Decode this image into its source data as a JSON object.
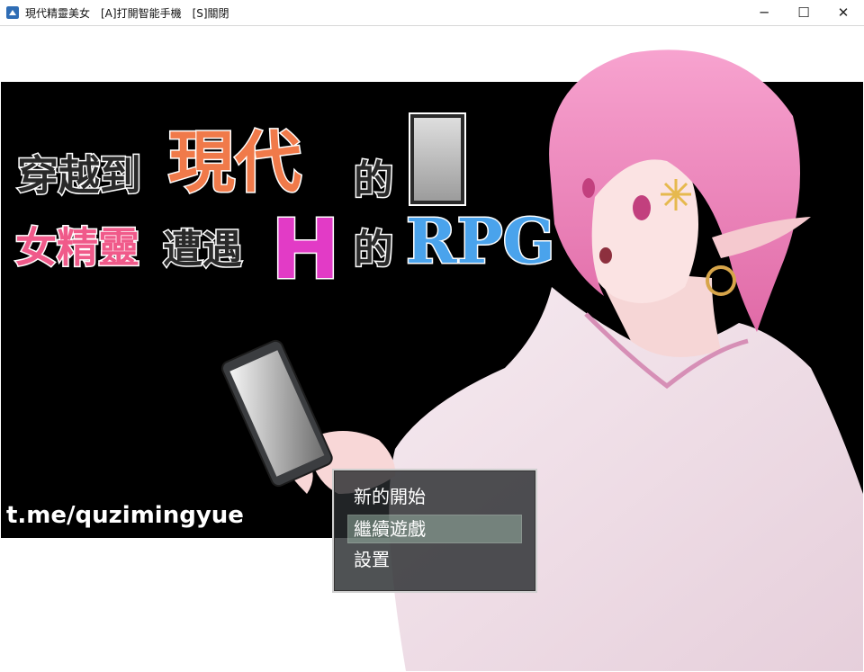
{
  "window": {
    "title": "現代精靈美女　[A]打開智能手機　[S]關閉",
    "minimize_glyph": "─",
    "maximize_glyph": "☐",
    "close_glyph": "✕",
    "icon": "app-icon"
  },
  "game_title": {
    "line1_a": "穿越到",
    "line1_b": "現代",
    "line1_c": "的",
    "line2_a": "女精靈",
    "line2_b": "遭遇",
    "line2_c": "H",
    "line2_d": "的",
    "line2_e": "RPG",
    "colors": {
      "dark_text": "#2a2a2a",
      "orange": "#f07a4a",
      "pink": "#f05a8a",
      "magenta": "#e23bc6",
      "blue": "#4aa3ec"
    }
  },
  "watermark": "t.me/quzimingyue",
  "title_menu": {
    "items": [
      "新的開始",
      "繼續遊戲",
      "設置"
    ],
    "selected_index": 1
  }
}
